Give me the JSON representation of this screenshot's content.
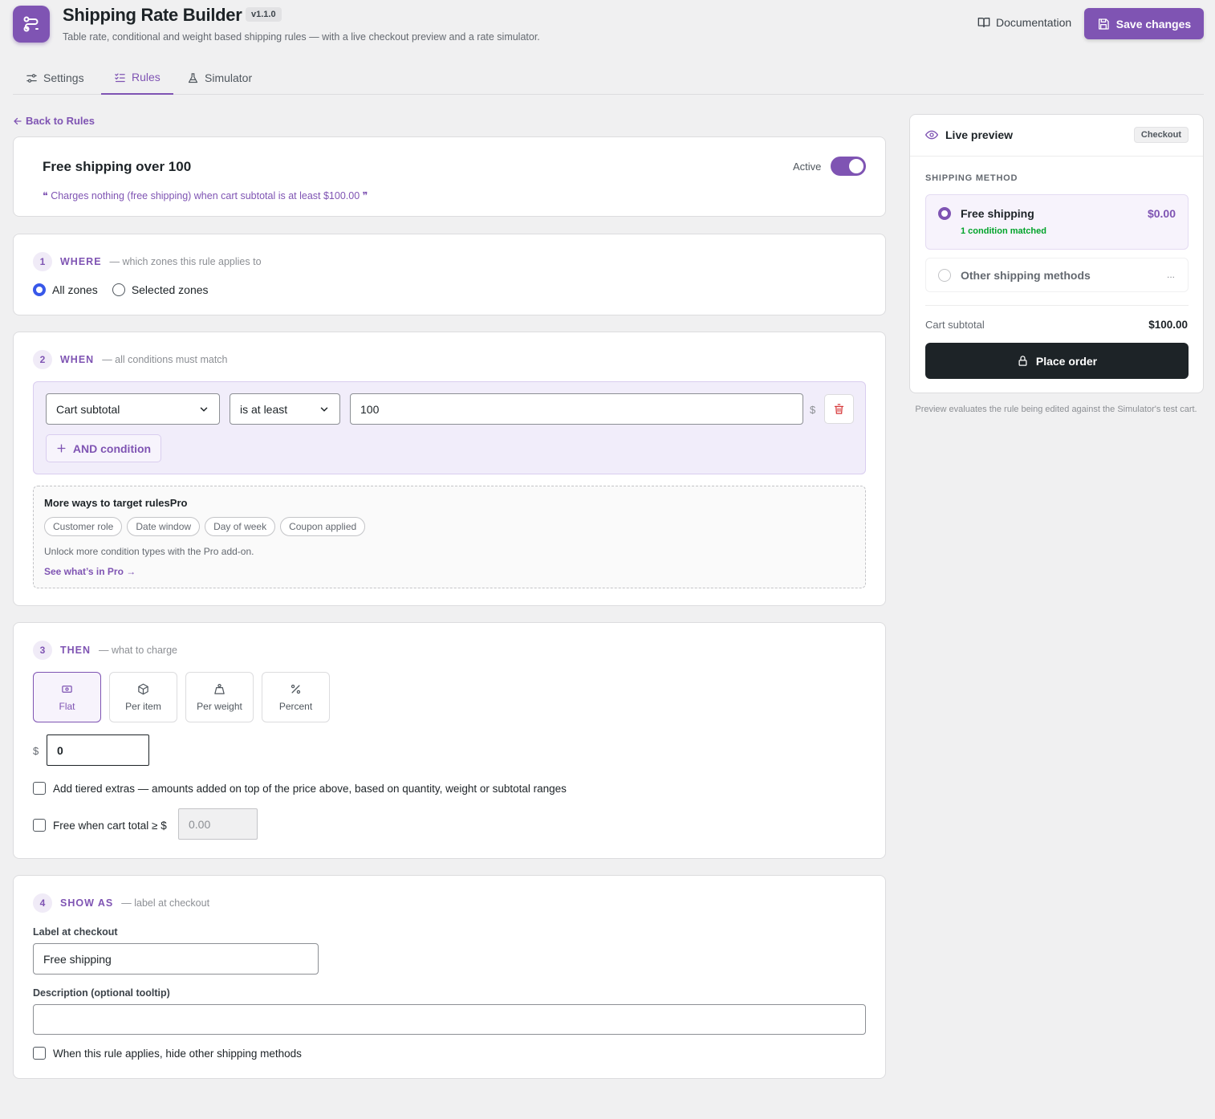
{
  "header": {
    "title": "Shipping Rate Builder",
    "version": "v1.1.0",
    "subtitle": "Table rate, conditional and weight based shipping rules — with a live checkout preview and a rate simulator.",
    "documentation_label": "Documentation",
    "save_label": "Save changes"
  },
  "tabs": [
    {
      "label": "Settings",
      "icon": "sliders-icon",
      "active": false
    },
    {
      "label": "Rules",
      "icon": "checklist-icon",
      "active": true
    },
    {
      "label": "Simulator",
      "icon": "flask-icon",
      "active": false
    }
  ],
  "back_label": "Back to Rules",
  "rule": {
    "title": "Free shipping over 100",
    "summary": "Charges nothing (free shipping) when cart subtotal is at least $100.00",
    "active_label": "Active",
    "active": true
  },
  "where": {
    "number": "1",
    "title": "WHERE",
    "hint": "— which zones this rule applies to",
    "options": [
      "All zones",
      "Selected zones"
    ],
    "selected": "All zones"
  },
  "when": {
    "number": "2",
    "title": "WHEN",
    "hint": "— all conditions must match",
    "condition": {
      "field": "Cart subtotal",
      "operator": "is at least",
      "value": "100",
      "suffix": "$"
    },
    "and_label": "AND condition",
    "pro": {
      "title": "More ways to target rulesPro",
      "chips": [
        "Customer role",
        "Date window",
        "Day of week",
        "Coupon applied"
      ],
      "note": "Unlock more condition types with the Pro add-on.",
      "link": "See what’s in Pro →"
    }
  },
  "then": {
    "number": "3",
    "title": "THEN",
    "hint": "— what to charge",
    "methods": [
      {
        "label": "Flat",
        "icon": "banknote-icon",
        "active": true
      },
      {
        "label": "Per item",
        "icon": "box-icon",
        "active": false
      },
      {
        "label": "Per weight",
        "icon": "weight-icon",
        "active": false
      },
      {
        "label": "Percent",
        "icon": "percent-icon",
        "active": false
      }
    ],
    "currency": "$",
    "amount": "0",
    "tiered_label": "Add tiered extras — amounts added on top of the price above, based on quantity, weight or subtotal ranges",
    "free_label": "Free when cart total ≥ $",
    "free_placeholder": "0.00"
  },
  "show_as": {
    "number": "4",
    "title": "SHOW AS",
    "hint": "— label at checkout",
    "label_field_label": "Label at checkout",
    "label_value": "Free shipping",
    "description_label": "Description (optional tooltip)",
    "description_value": "",
    "hide_label": "When this rule applies, hide other shipping methods"
  },
  "preview": {
    "title": "Live preview",
    "badge": "Checkout",
    "section_label": "SHIPPING METHOD",
    "selected_method": "Free shipping",
    "selected_price": "$0.00",
    "selected_note": "1 condition matched",
    "other_method": "Other shipping methods",
    "other_dots": "...",
    "subtotal_label": "Cart subtotal",
    "subtotal_value": "$100.00",
    "place_order_label": "Place order",
    "note": "Preview evaluates the rule being edited against the Simulator's test cart."
  },
  "colors": {
    "accent": "#7f54b3",
    "dark": "#1d2327",
    "success": "#00a32a",
    "danger": "#d63638",
    "radio": "#3858e9"
  }
}
